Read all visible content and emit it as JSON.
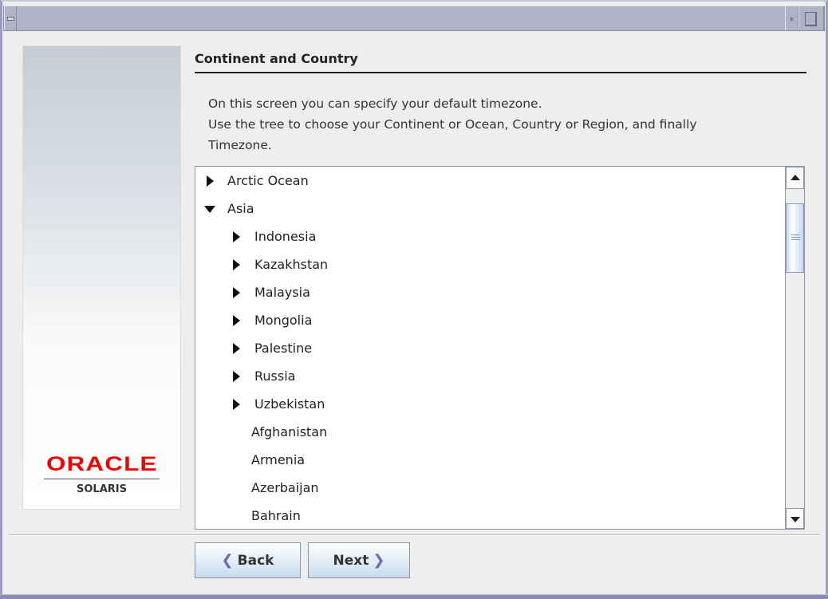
{
  "window": {
    "title": ""
  },
  "sidebar": {
    "logo_brand": "ORACLE",
    "logo_product": "SOLARIS"
  },
  "main": {
    "heading": "Continent and Country",
    "description": [
      "On this screen you can specify your default timezone.",
      "Use the tree to choose your Continent or Ocean, Country or Region, and finally",
      "Timezone."
    ],
    "tree": [
      {
        "label": "Arctic Ocean",
        "level": 0,
        "state": "collapsed"
      },
      {
        "label": "Asia",
        "level": 0,
        "state": "expanded"
      },
      {
        "label": "Indonesia",
        "level": 1,
        "state": "collapsed"
      },
      {
        "label": "Kazakhstan",
        "level": 1,
        "state": "collapsed"
      },
      {
        "label": "Malaysia",
        "level": 1,
        "state": "collapsed"
      },
      {
        "label": "Mongolia",
        "level": 1,
        "state": "collapsed"
      },
      {
        "label": "Palestine",
        "level": 1,
        "state": "collapsed"
      },
      {
        "label": "Russia",
        "level": 1,
        "state": "collapsed"
      },
      {
        "label": "Uzbekistan",
        "level": 1,
        "state": "collapsed"
      },
      {
        "label": "Afghanistan",
        "level": 1,
        "state": "leaf"
      },
      {
        "label": "Armenia",
        "level": 1,
        "state": "leaf"
      },
      {
        "label": "Azerbaijan",
        "level": 1,
        "state": "leaf"
      },
      {
        "label": "Bahrain",
        "level": 1,
        "state": "leaf"
      }
    ]
  },
  "buttons": {
    "back": "Back",
    "next": "Next"
  },
  "colors": {
    "brand": "#f20000",
    "titlebar": "#b0b3c5",
    "accent": "#7b9ad6"
  }
}
